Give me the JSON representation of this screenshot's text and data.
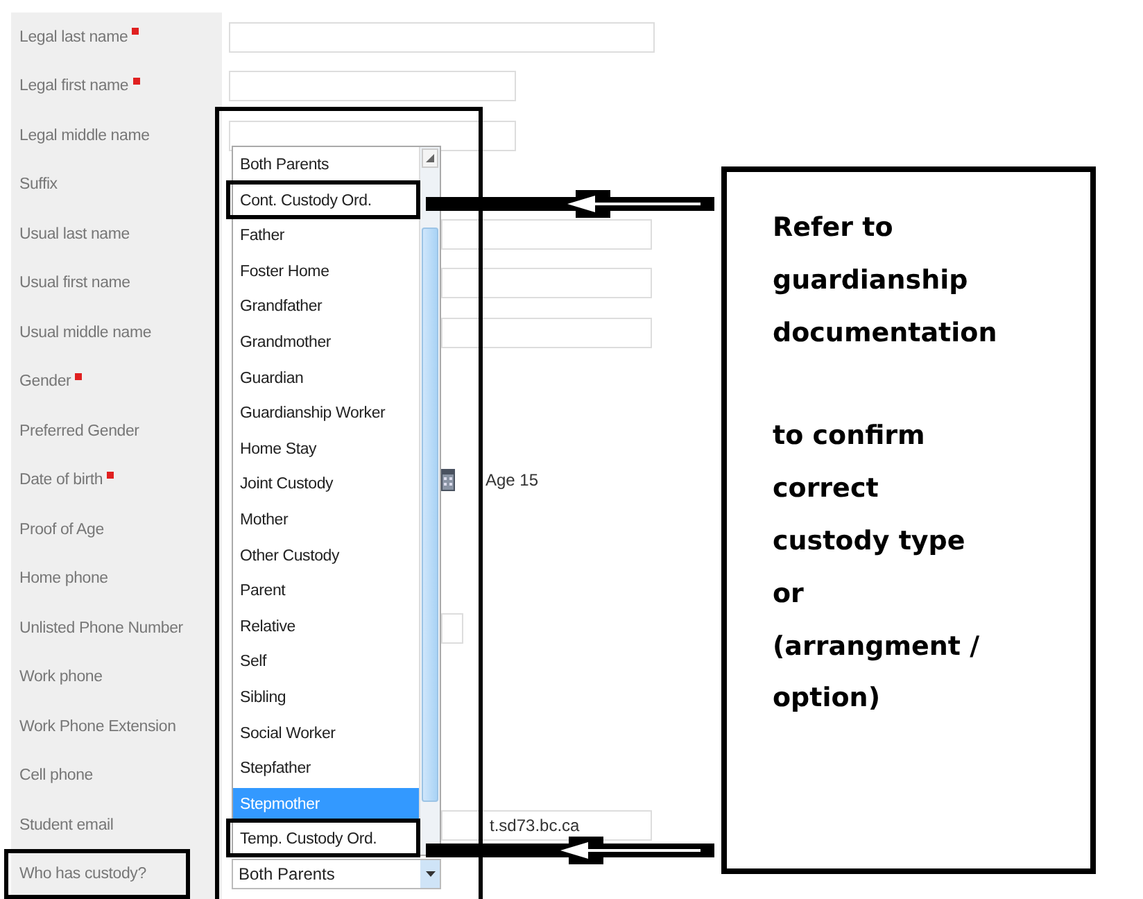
{
  "form": {
    "fields": [
      {
        "label": "Legal last name",
        "required": true,
        "kind": "text",
        "outlined": false
      },
      {
        "label": "Legal first name",
        "required": true,
        "kind": "short_text",
        "outlined": false
      },
      {
        "label": "Legal middle name",
        "required": false,
        "kind": "short_text",
        "outlined": false
      },
      {
        "label": "Suffix",
        "required": false,
        "kind": "none",
        "outlined": false
      },
      {
        "label": "Usual last name",
        "required": false,
        "kind": "partial_text",
        "outlined": false
      },
      {
        "label": "Usual first name",
        "required": false,
        "kind": "partial_text",
        "outlined": false
      },
      {
        "label": "Usual middle name",
        "required": false,
        "kind": "partial_text",
        "outlined": false
      },
      {
        "label": "Gender",
        "required": true,
        "kind": "none",
        "outlined": false
      },
      {
        "label": "Preferred Gender",
        "required": false,
        "kind": "none",
        "outlined": false
      },
      {
        "label": "Date of birth",
        "required": true,
        "kind": "date",
        "age": "Age 15",
        "outlined": false
      },
      {
        "label": "Proof of Age",
        "required": false,
        "kind": "none",
        "outlined": false
      },
      {
        "label": "Home phone",
        "required": false,
        "kind": "none",
        "outlined": false
      },
      {
        "label": "Unlisted Phone Number",
        "required": false,
        "kind": "partial_short",
        "outlined": false
      },
      {
        "label": "Work phone",
        "required": false,
        "kind": "none",
        "outlined": false
      },
      {
        "label": "Work Phone Extension",
        "required": false,
        "kind": "none",
        "outlined": false
      },
      {
        "label": "Cell phone",
        "required": false,
        "kind": "none",
        "outlined": false
      },
      {
        "label": "Student email",
        "required": false,
        "kind": "partial_text",
        "value": "t.sd73.bc.ca",
        "outlined": false
      },
      {
        "label": "Who has custody?",
        "required": false,
        "kind": "select",
        "value": "Both Parents",
        "outlined": true
      }
    ]
  },
  "dropdown": {
    "options": [
      {
        "label": "Both Parents",
        "selected": false,
        "outlined": false
      },
      {
        "label": "Cont. Custody Ord.",
        "selected": false,
        "outlined": true
      },
      {
        "label": "Father",
        "selected": false,
        "outlined": false
      },
      {
        "label": "Foster Home",
        "selected": false,
        "outlined": false
      },
      {
        "label": "Grandfather",
        "selected": false,
        "outlined": false
      },
      {
        "label": "Grandmother",
        "selected": false,
        "outlined": false
      },
      {
        "label": "Guardian",
        "selected": false,
        "outlined": false
      },
      {
        "label": "Guardianship Worker",
        "selected": false,
        "outlined": false
      },
      {
        "label": "Home Stay",
        "selected": false,
        "outlined": false
      },
      {
        "label": "Joint Custody",
        "selected": false,
        "outlined": false
      },
      {
        "label": "Mother",
        "selected": false,
        "outlined": false
      },
      {
        "label": "Other Custody",
        "selected": false,
        "outlined": false
      },
      {
        "label": "Parent",
        "selected": false,
        "outlined": false
      },
      {
        "label": "Relative",
        "selected": false,
        "outlined": false
      },
      {
        "label": "Self",
        "selected": false,
        "outlined": false
      },
      {
        "label": "Sibling",
        "selected": false,
        "outlined": false
      },
      {
        "label": "Social Worker",
        "selected": false,
        "outlined": false
      },
      {
        "label": "Stepfather",
        "selected": false,
        "outlined": false
      },
      {
        "label": "Stepmother",
        "selected": true,
        "outlined": false
      },
      {
        "label": "Temp. Custody Ord.",
        "selected": false,
        "outlined": true
      }
    ]
  },
  "note": {
    "paragraphs": [
      [
        "Refer to",
        "guardianship",
        "documentation"
      ],
      [
        "to confirm",
        "correct",
        "custody type",
        "or",
        "(arrangment /",
        "option)"
      ]
    ]
  }
}
